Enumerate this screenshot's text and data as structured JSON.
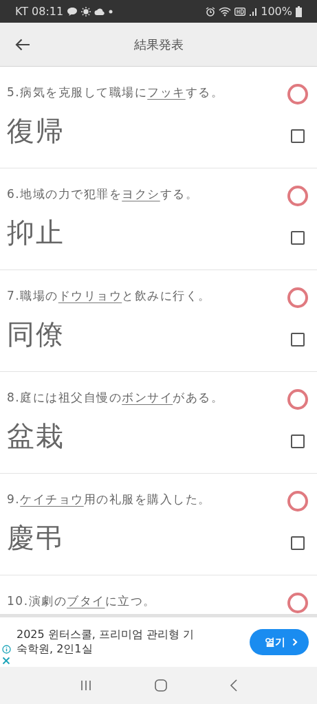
{
  "status_bar": {
    "carrier_time": "KT 08:11",
    "battery": "100%"
  },
  "app_bar": {
    "title": "結果発表"
  },
  "questions": [
    {
      "before": "5.病気を克服して職場に",
      "target": "フッキ",
      "after": "する。",
      "correct": true,
      "answer": "復帰",
      "checked": false
    },
    {
      "before": "6.地域の力で犯罪を",
      "target": "ヨクシ",
      "after": "する。",
      "correct": true,
      "answer": "抑止",
      "checked": false
    },
    {
      "before": "7.職場の",
      "target": "ドウリョウ",
      "after": "と飲みに行く。",
      "correct": true,
      "answer": "同僚",
      "checked": false
    },
    {
      "before": "8.庭には祖父自慢の",
      "target": "ボンサイ",
      "after": "がある。",
      "correct": true,
      "answer": "盆栽",
      "checked": false
    },
    {
      "before": "9.",
      "target": "ケイチョウ",
      "after": "用の礼服を購入した。",
      "correct": true,
      "answer": "慶弔",
      "checked": false
    },
    {
      "before": "10.演劇の",
      "target": "ブタイ",
      "after": "に立つ。",
      "correct": true
    }
  ],
  "ad": {
    "text": "2025 윈터스쿨, 프리미엄 관리형 기숙학원, 2인1실",
    "button": "열기"
  }
}
